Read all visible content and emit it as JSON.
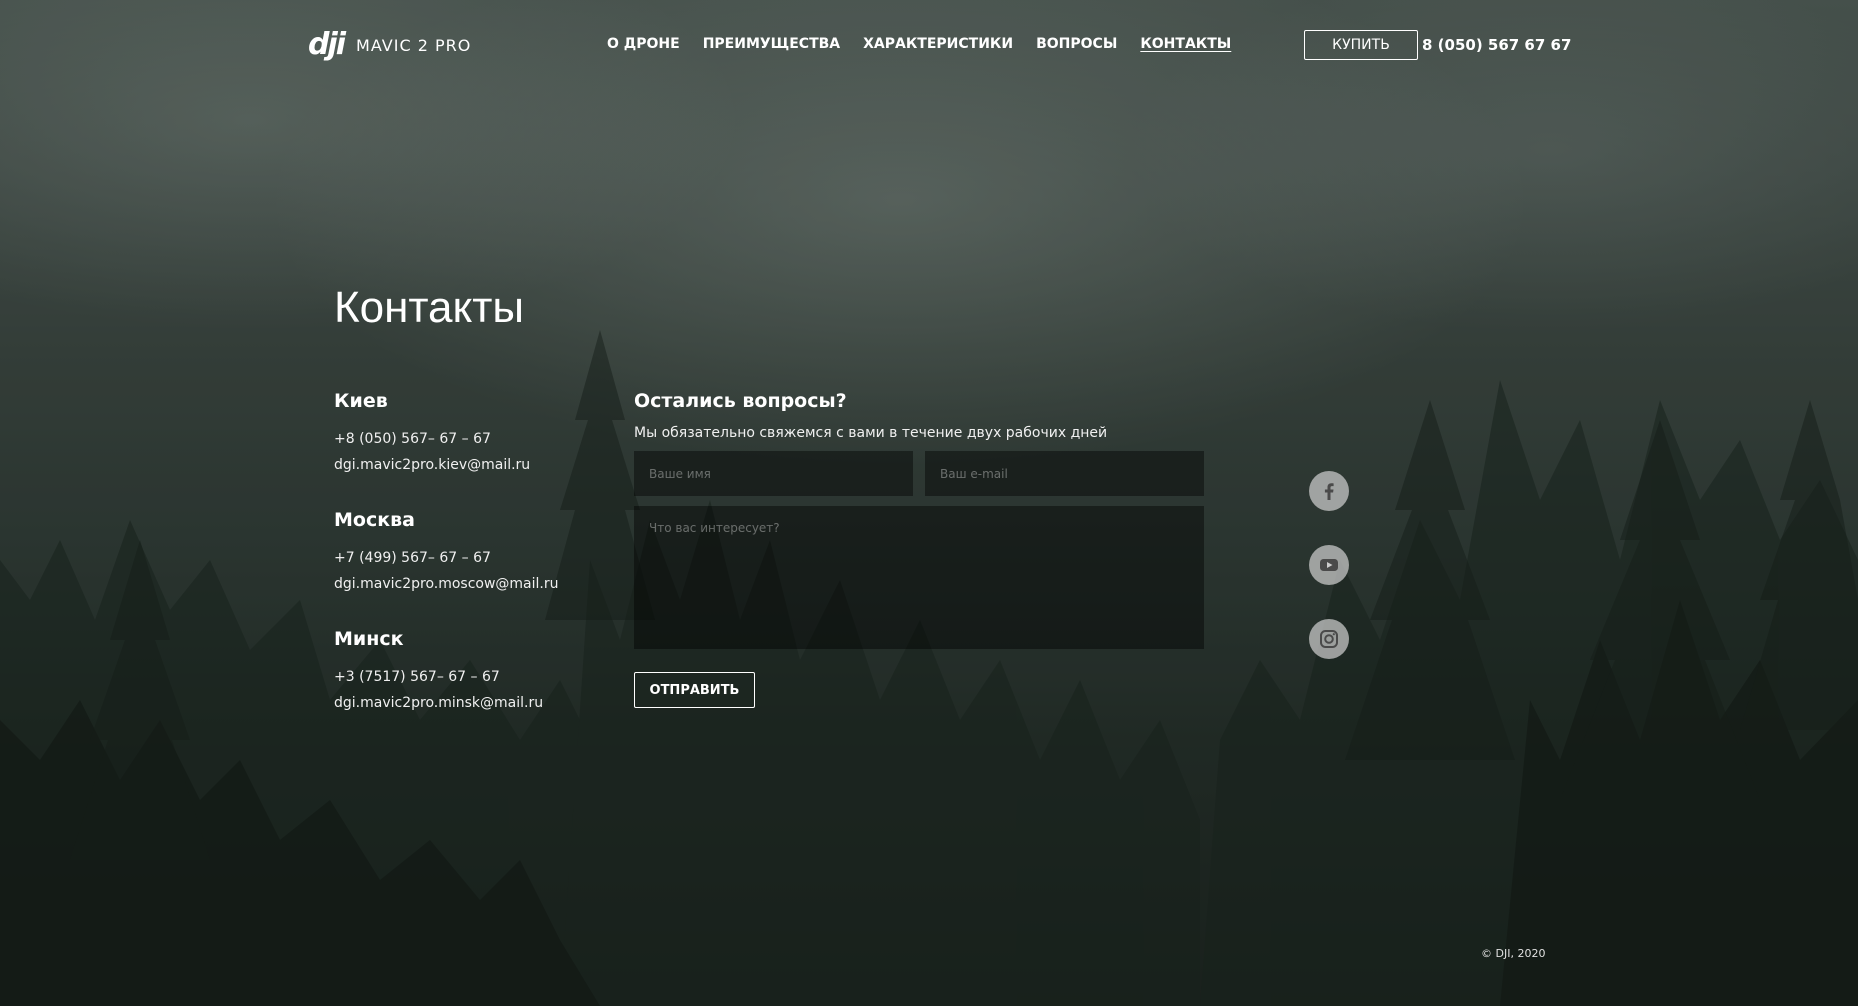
{
  "header": {
    "logo_mark": "dji",
    "logo_model": "MAVIC 2 PRO",
    "nav": [
      {
        "label": "О ДРОНЕ",
        "active": false
      },
      {
        "label": "ПРЕИМУЩЕСТВА",
        "active": false
      },
      {
        "label": "ХАРАКТЕРИСТИКИ",
        "active": false
      },
      {
        "label": "ВОПРОСЫ",
        "active": false
      },
      {
        "label": "КОНТАКТЫ",
        "active": true
      }
    ],
    "buy_label": "КУПИТЬ",
    "phone": "8 (050) 567 67 67"
  },
  "contacts": {
    "title": "Контакты",
    "cities": [
      {
        "name": "Киев",
        "phone": "+8 (050) 567– 67 – 67",
        "email": "dgi.mavic2pro.kiev@mail.ru"
      },
      {
        "name": "Москва",
        "phone": "+7 (499) 567– 67 – 67",
        "email": "dgi.mavic2pro.moscow@mail.ru"
      },
      {
        "name": "Минск",
        "phone": "+3 (7517) 567– 67 – 67",
        "email": "dgi.mavic2pro.minsk@mail.ru"
      }
    ]
  },
  "form": {
    "title": "Остались вопросы?",
    "subtitle": "Мы обязательно свяжемся с вами в течение двух рабочих дней",
    "name_placeholder": "Ваше имя",
    "email_placeholder": "Ваш e-mail",
    "message_placeholder": "Что вас интересует?",
    "name_value": "",
    "email_value": "",
    "message_value": "",
    "submit_label": "ОТПРАВИТЬ"
  },
  "social": [
    {
      "icon": "facebook-icon"
    },
    {
      "icon": "youtube-icon"
    },
    {
      "icon": "instagram-icon"
    }
  ],
  "footer": {
    "copyright": "© DJI, 2020"
  },
  "colors": {
    "text": "#ffffff",
    "field_bg": "rgba(0,0,0,0.42)",
    "social_bg": "#cdcdcd",
    "icon": "#4a4a4a"
  }
}
